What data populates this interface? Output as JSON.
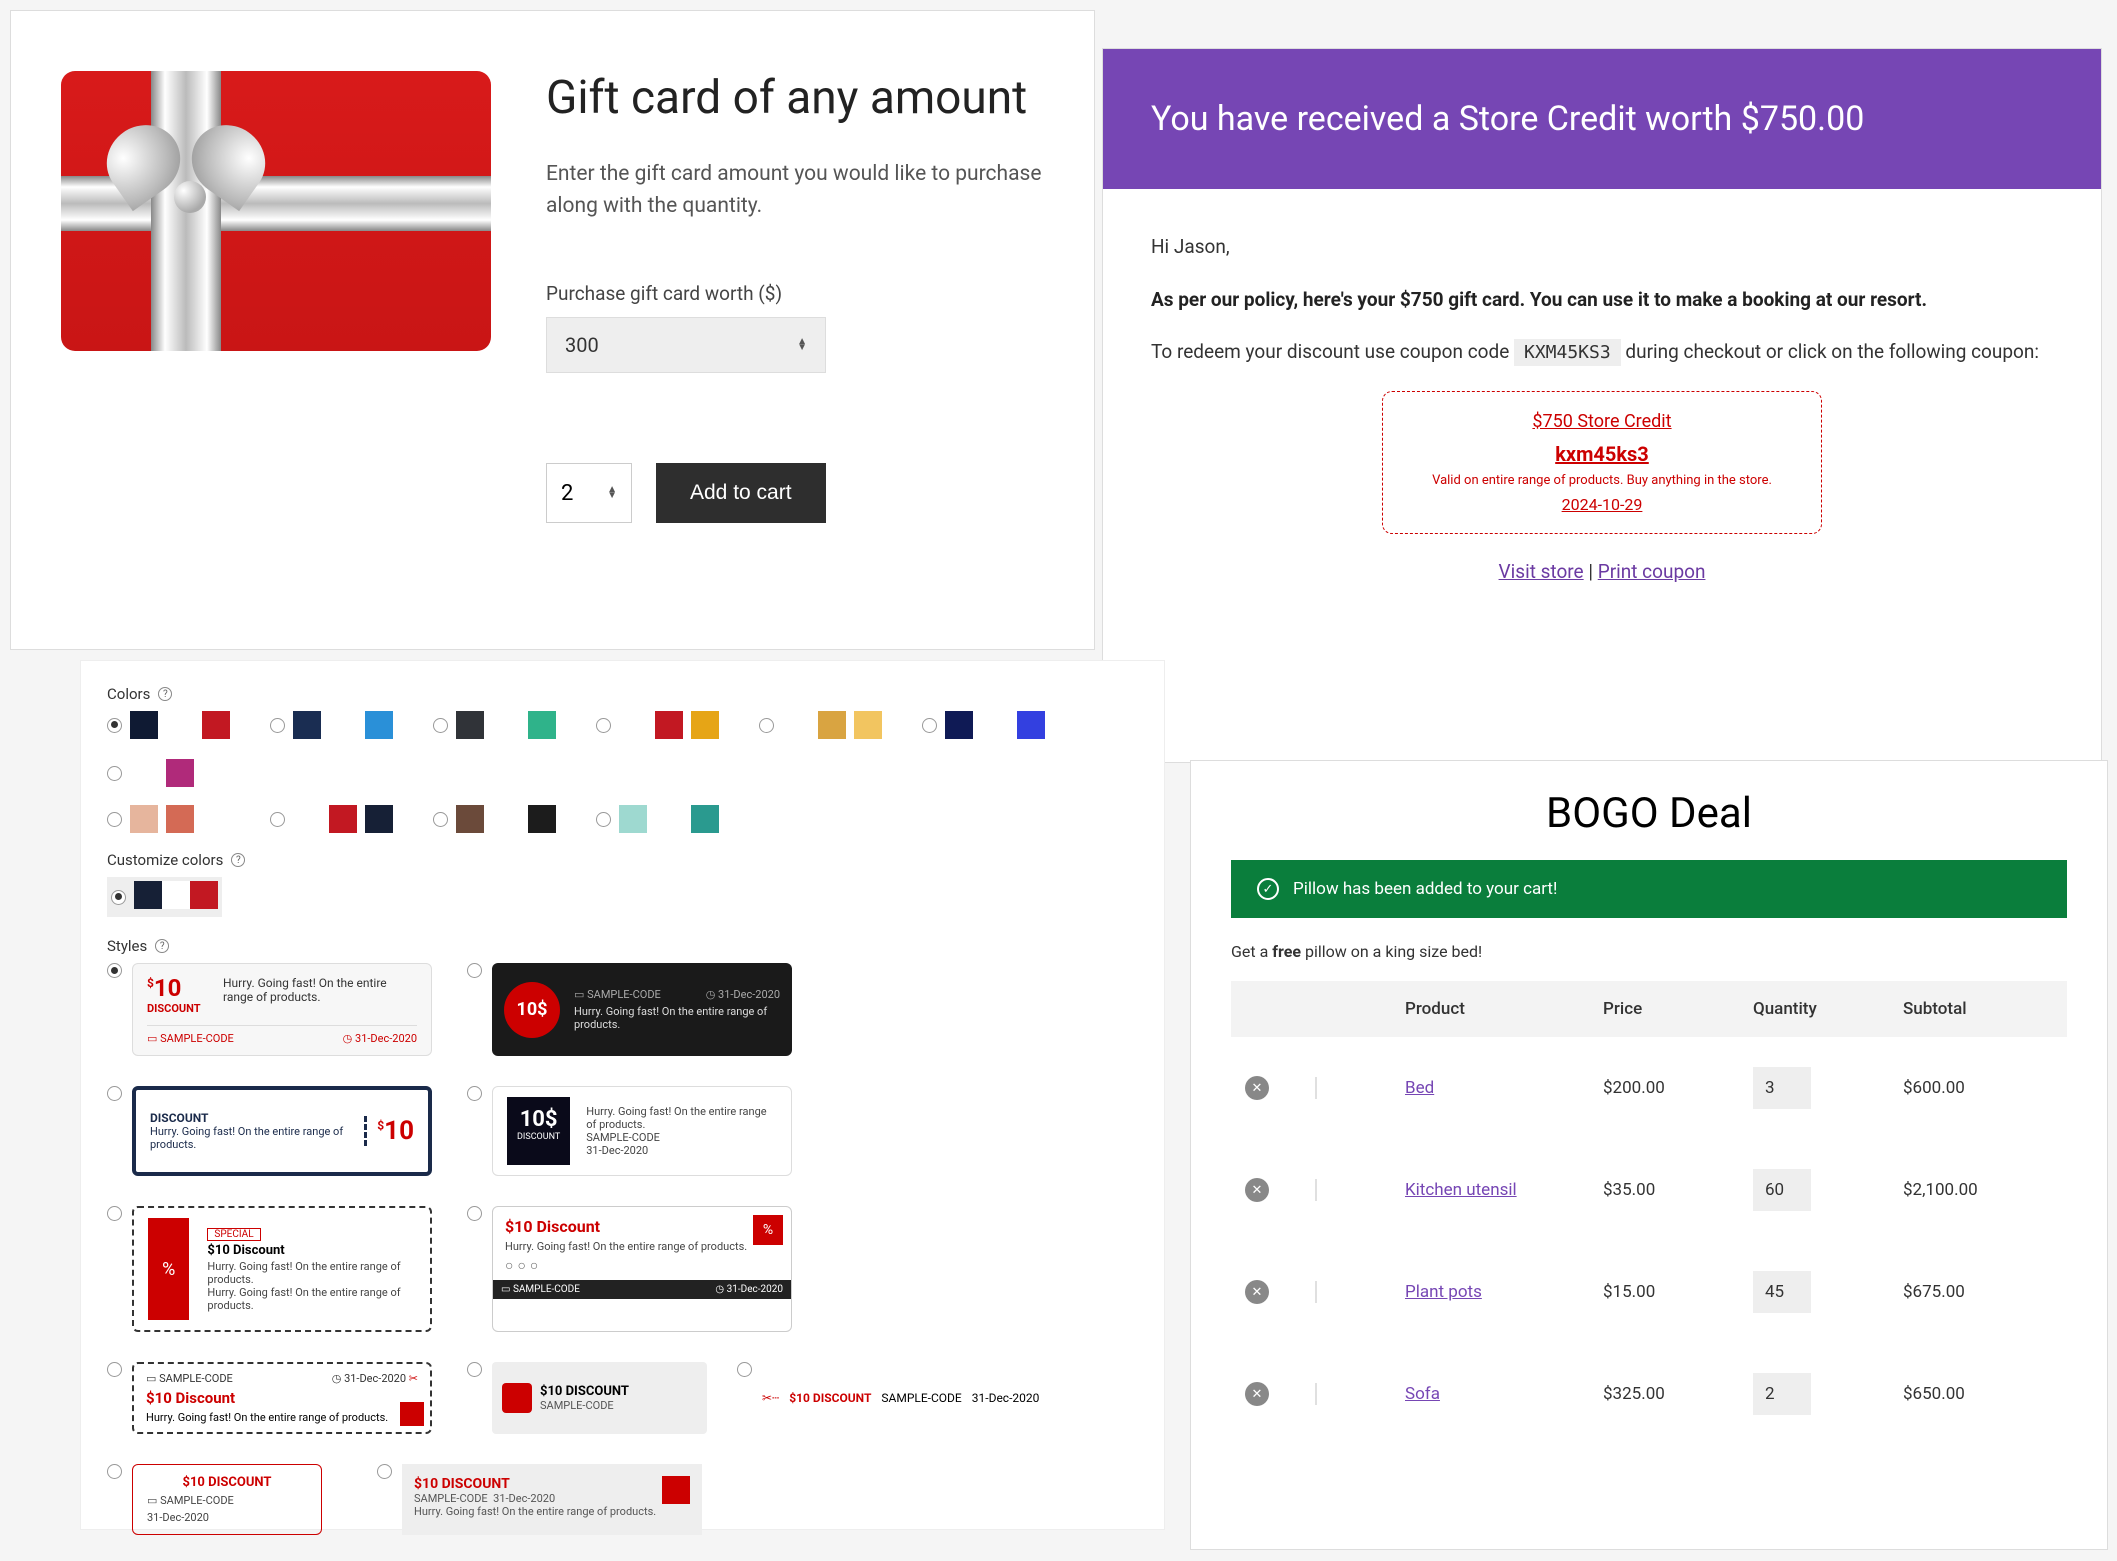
{
  "gift_card_panel": {
    "title": "Gift card of any amount",
    "description": "Enter the gift card amount you would like to purchase along with the quantity.",
    "amount_label": "Purchase gift card worth ($)",
    "amount_value": "300",
    "quantity_value": "2",
    "add_to_cart_label": "Add to cart"
  },
  "store_credit_email": {
    "header": "You have received a Store Credit worth $750.00",
    "greeting": "Hi Jason,",
    "policy_line": "As per our policy, here's your $750 gift card. You can use it to make a booking at our resort.",
    "redeem_pre": "To redeem your discount use coupon code ",
    "coupon_code_inline": "KXM45KS3",
    "redeem_post": " during checkout or click on the following coupon:",
    "coupon_box": {
      "title": "$750 Store Credit",
      "code": "kxm45ks3",
      "valid_text": "Valid on entire range of products. Buy anything in the store.",
      "expiry": "2024-10-29"
    },
    "visit_store": "Visit store",
    "print_coupon": "Print coupon"
  },
  "coupon_styles_panel": {
    "colors_label": "Colors",
    "customize_label": "Customize colors",
    "styles_label": "Styles",
    "color_swatches_row1": [
      [
        "#0f1a33",
        "#ffffff",
        "#c21822"
      ],
      [
        "#1a2d52",
        "#ffffff",
        "#2a90d8"
      ],
      [
        "#303338",
        "#ffffff",
        "#2fb38a"
      ],
      [
        "#ffffff",
        "#c21822",
        "#e6a516"
      ],
      [
        "#ffffff",
        "#d9a441",
        "#f2c560"
      ],
      [
        "#0f1a55",
        "#ffffff",
        "#3340e0"
      ],
      [
        "#ffffff",
        "#b02a7a"
      ]
    ],
    "color_swatches_row2": [
      [
        "#e6b59d",
        "#d46a55",
        "#ffffff"
      ],
      [
        "#ffffff",
        "#c21822",
        "#162036"
      ],
      [
        "#6b4a3a",
        "#ffffff",
        "#1c1c1c"
      ],
      [
        "#9ed9d0",
        "#ffffff",
        "#2a9a8f"
      ]
    ],
    "customize_swatch": [
      "#162036",
      "#ffffff",
      "#c21822"
    ],
    "sample": {
      "amount": "$10",
      "amount_alt": "10$",
      "amount_title": "$10 Discount",
      "amount_upper": "$10 DISCOUNT",
      "discount_word": "DISCOUNT",
      "special_word": "SPECIAL",
      "hurry": "Hurry. Going fast! On the entire range of products.",
      "code": "SAMPLE-CODE",
      "expiry": "31-Dec-2020"
    }
  },
  "bogo_panel": {
    "title": "BOGO Deal",
    "notice": "Pillow has been added to your cart!",
    "subtext_pre": "Get a ",
    "subtext_bold": "free",
    "subtext_post": " pillow on a king size bed!",
    "columns": {
      "product": "Product",
      "price": "Price",
      "quantity": "Quantity",
      "subtotal": "Subtotal"
    },
    "rows": [
      {
        "name": "Bed",
        "price": "$200.00",
        "qty": "3",
        "subtotal": "$600.00"
      },
      {
        "name": "Kitchen utensil",
        "price": "$35.00",
        "qty": "60",
        "subtotal": "$2,100.00"
      },
      {
        "name": "Plant pots",
        "price": "$15.00",
        "qty": "45",
        "subtotal": "$675.00"
      },
      {
        "name": "Sofa",
        "price": "$325.00",
        "qty": "2",
        "subtotal": "$650.00"
      }
    ]
  }
}
